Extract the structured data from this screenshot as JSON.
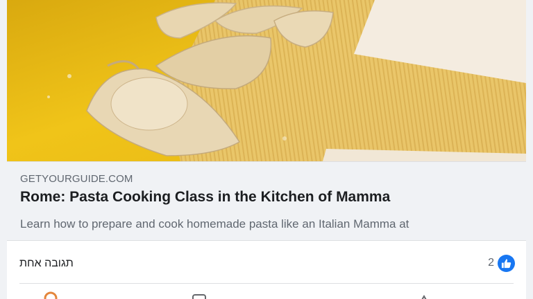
{
  "preview": {
    "domain": "GETYOURGUIDE.COM",
    "title": "Rome: Pasta Cooking Class in the Kitchen of Mamma",
    "description": "Learn how to prepare and cook homemade pasta like an Italian Mamma at"
  },
  "footer": {
    "comments_text": "תגובה אחת",
    "reaction_count": "2",
    "reaction_icon": "like-thumb-icon"
  },
  "actions": [
    "like-icon",
    "comment-icon",
    "share-icon"
  ],
  "colors": {
    "accent": "#1877f2",
    "table_yellow": "#f0c419",
    "dough": "#e9d8b2"
  }
}
